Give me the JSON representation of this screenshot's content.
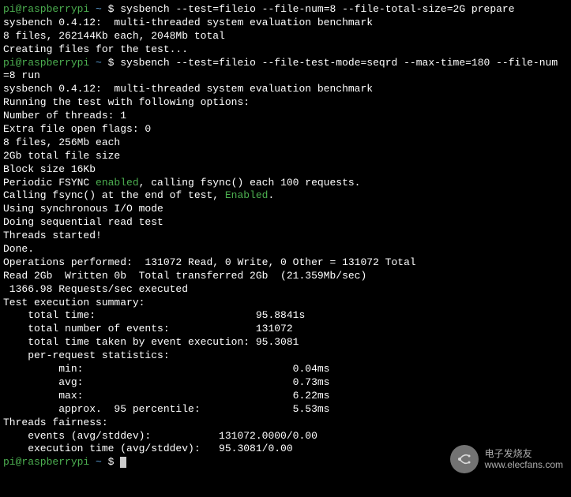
{
  "prompt": {
    "user": "pi@raspberrypi",
    "sep1": " ",
    "tilde": "~",
    "sep2": " $ "
  },
  "cmd1": "sysbench --test=fileio --file-num=8 --file-total-size=2G prepare",
  "out1": {
    "l1": "sysbench 0.4.12:  multi-threaded system evaluation benchmark",
    "l2": "",
    "l3": "8 files, 262144Kb each, 2048Mb total",
    "l4": "Creating files for the test..."
  },
  "cmd2a": "sysbench --test=fileio --file-test-mode=seqrd --max-time=180 --file-num",
  "cmd2b": "=8 run",
  "out2": {
    "l1": "sysbench 0.4.12:  multi-threaded system evaluation benchmark",
    "l2": "",
    "l3": "Running the test with following options:",
    "l4": "Number of threads: 1",
    "l5": "",
    "l6": "Extra file open flags: 0",
    "l7": "8 files, 256Mb each",
    "l8": "2Gb total file size",
    "l9": "Block size 16Kb",
    "l10a": "Periodic FSYNC ",
    "l10b": "enabled",
    "l10c": ", calling fsync() each 100 requests.",
    "l11a": "Calling fsync() at the end of test, ",
    "l11b": "Enabled",
    "l11c": ".",
    "l12": "Using synchronous I/O mode",
    "l13": "Doing sequential read test",
    "l14": "Threads started!",
    "l15": "Done.",
    "l16": "",
    "l17": "Operations performed:  131072 Read, 0 Write, 0 Other = 131072 Total",
    "l18": "Read 2Gb  Written 0b  Total transferred 2Gb  (21.359Mb/sec)",
    "l19": " 1366.98 Requests/sec executed",
    "l20": "",
    "l21": "Test execution summary:",
    "l22": "    total time:                          95.8841s",
    "l23": "    total number of events:              131072",
    "l24": "    total time taken by event execution: 95.3081",
    "l25": "    per-request statistics:",
    "l26": "         min:                                  0.04ms",
    "l27": "         avg:                                  0.73ms",
    "l28": "         max:                                  6.22ms",
    "l29": "         approx.  95 percentile:               5.53ms",
    "l30": "",
    "l31": "Threads fairness:",
    "l32": "    events (avg/stddev):           131072.0000/0.00",
    "l33": "    execution time (avg/stddev):   95.3081/0.00",
    "l34": ""
  },
  "watermark": {
    "line1": "电子发烧友",
    "line2": "www.elecfans.com"
  }
}
